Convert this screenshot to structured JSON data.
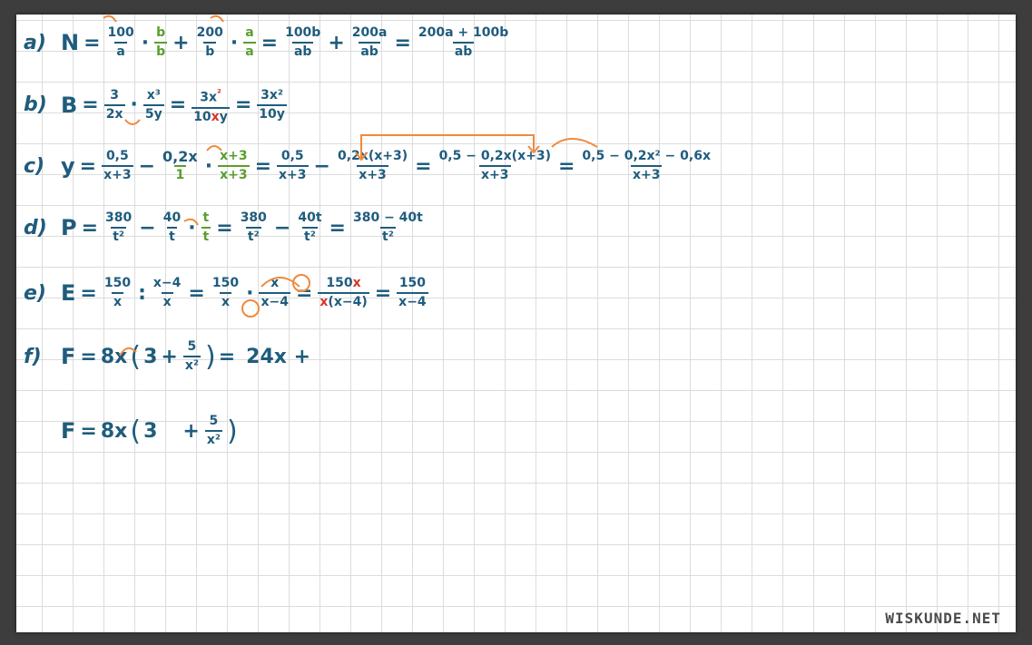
{
  "watermark": "WISKUNDE.NET",
  "rows": {
    "a": {
      "label": "a)",
      "var": "N",
      "t1n": "100",
      "t1d": "a",
      "g1n": "b",
      "g1d": "b",
      "t2n": "200",
      "t2d": "b",
      "g2n": "a",
      "g2d": "a",
      "r1n": "100b",
      "r1d": "ab",
      "r2n": "200a",
      "r2d": "ab",
      "r3n": "200a + 100b",
      "r3d": "ab"
    },
    "b": {
      "label": "b)",
      "var": "B",
      "t1n": "3",
      "t1d": "2x",
      "t2n": "x³",
      "t2d": "5y",
      "r1n_a": "3x",
      "r1n_b": "²",
      "r1d_a": "10",
      "r1d_x": "x",
      "r1d_b": "y",
      "r2n": "3x²",
      "r2d": "10y"
    },
    "c": {
      "label": "c)",
      "var": "y",
      "t1n": "0,5",
      "t1d": "x+3",
      "mid": "0,2x",
      "gn": "x+3",
      "gd": "x+3",
      "g1": "1",
      "r1n": "0,5",
      "r1d": "x+3",
      "r2n": "0,2x(x+3)",
      "r2d": "x+3",
      "r3n": "0,5 − 0,2x(x+3)",
      "r3d": "x+3",
      "r4n": "0,5 − 0,2x² − 0,6x",
      "r4d": "x+3"
    },
    "d": {
      "label": "d)",
      "var": "P",
      "t1n": "380",
      "t1d": "t²",
      "t2n": "40",
      "t2d": "t",
      "gn": "t",
      "gd": "t",
      "r1n": "380",
      "r1d": "t²",
      "r2n": "40t",
      "r2d": "t²",
      "r3n": "380 − 40t",
      "r3d": "t²"
    },
    "e": {
      "label": "e)",
      "var": "E",
      "t1n": "150",
      "t1d": "x",
      "t2n": "x−4",
      "t2d": "x",
      "r1n": "150",
      "r1d": "x",
      "r2n": "x",
      "r2d": "x−4",
      "r3n_a": "150",
      "r3n_x": "x",
      "r3d_x": "x",
      "r3d_b": "(x−4)",
      "r4n": "150",
      "r4d": "x−4"
    },
    "f": {
      "label": "f)",
      "var": "F",
      "coef": "8x",
      "three": "3",
      "fn": "5",
      "fd": "x²",
      "rhs": "24x +"
    },
    "g": {
      "var": "F",
      "coef": "8x",
      "three": "3",
      "fn": "5",
      "fd": "x²"
    }
  },
  "ops": {
    "eq": "=",
    "plus": "+",
    "minus": "−",
    "dot": "·",
    "colon": ":",
    "lp": "(",
    "rp": ")"
  }
}
